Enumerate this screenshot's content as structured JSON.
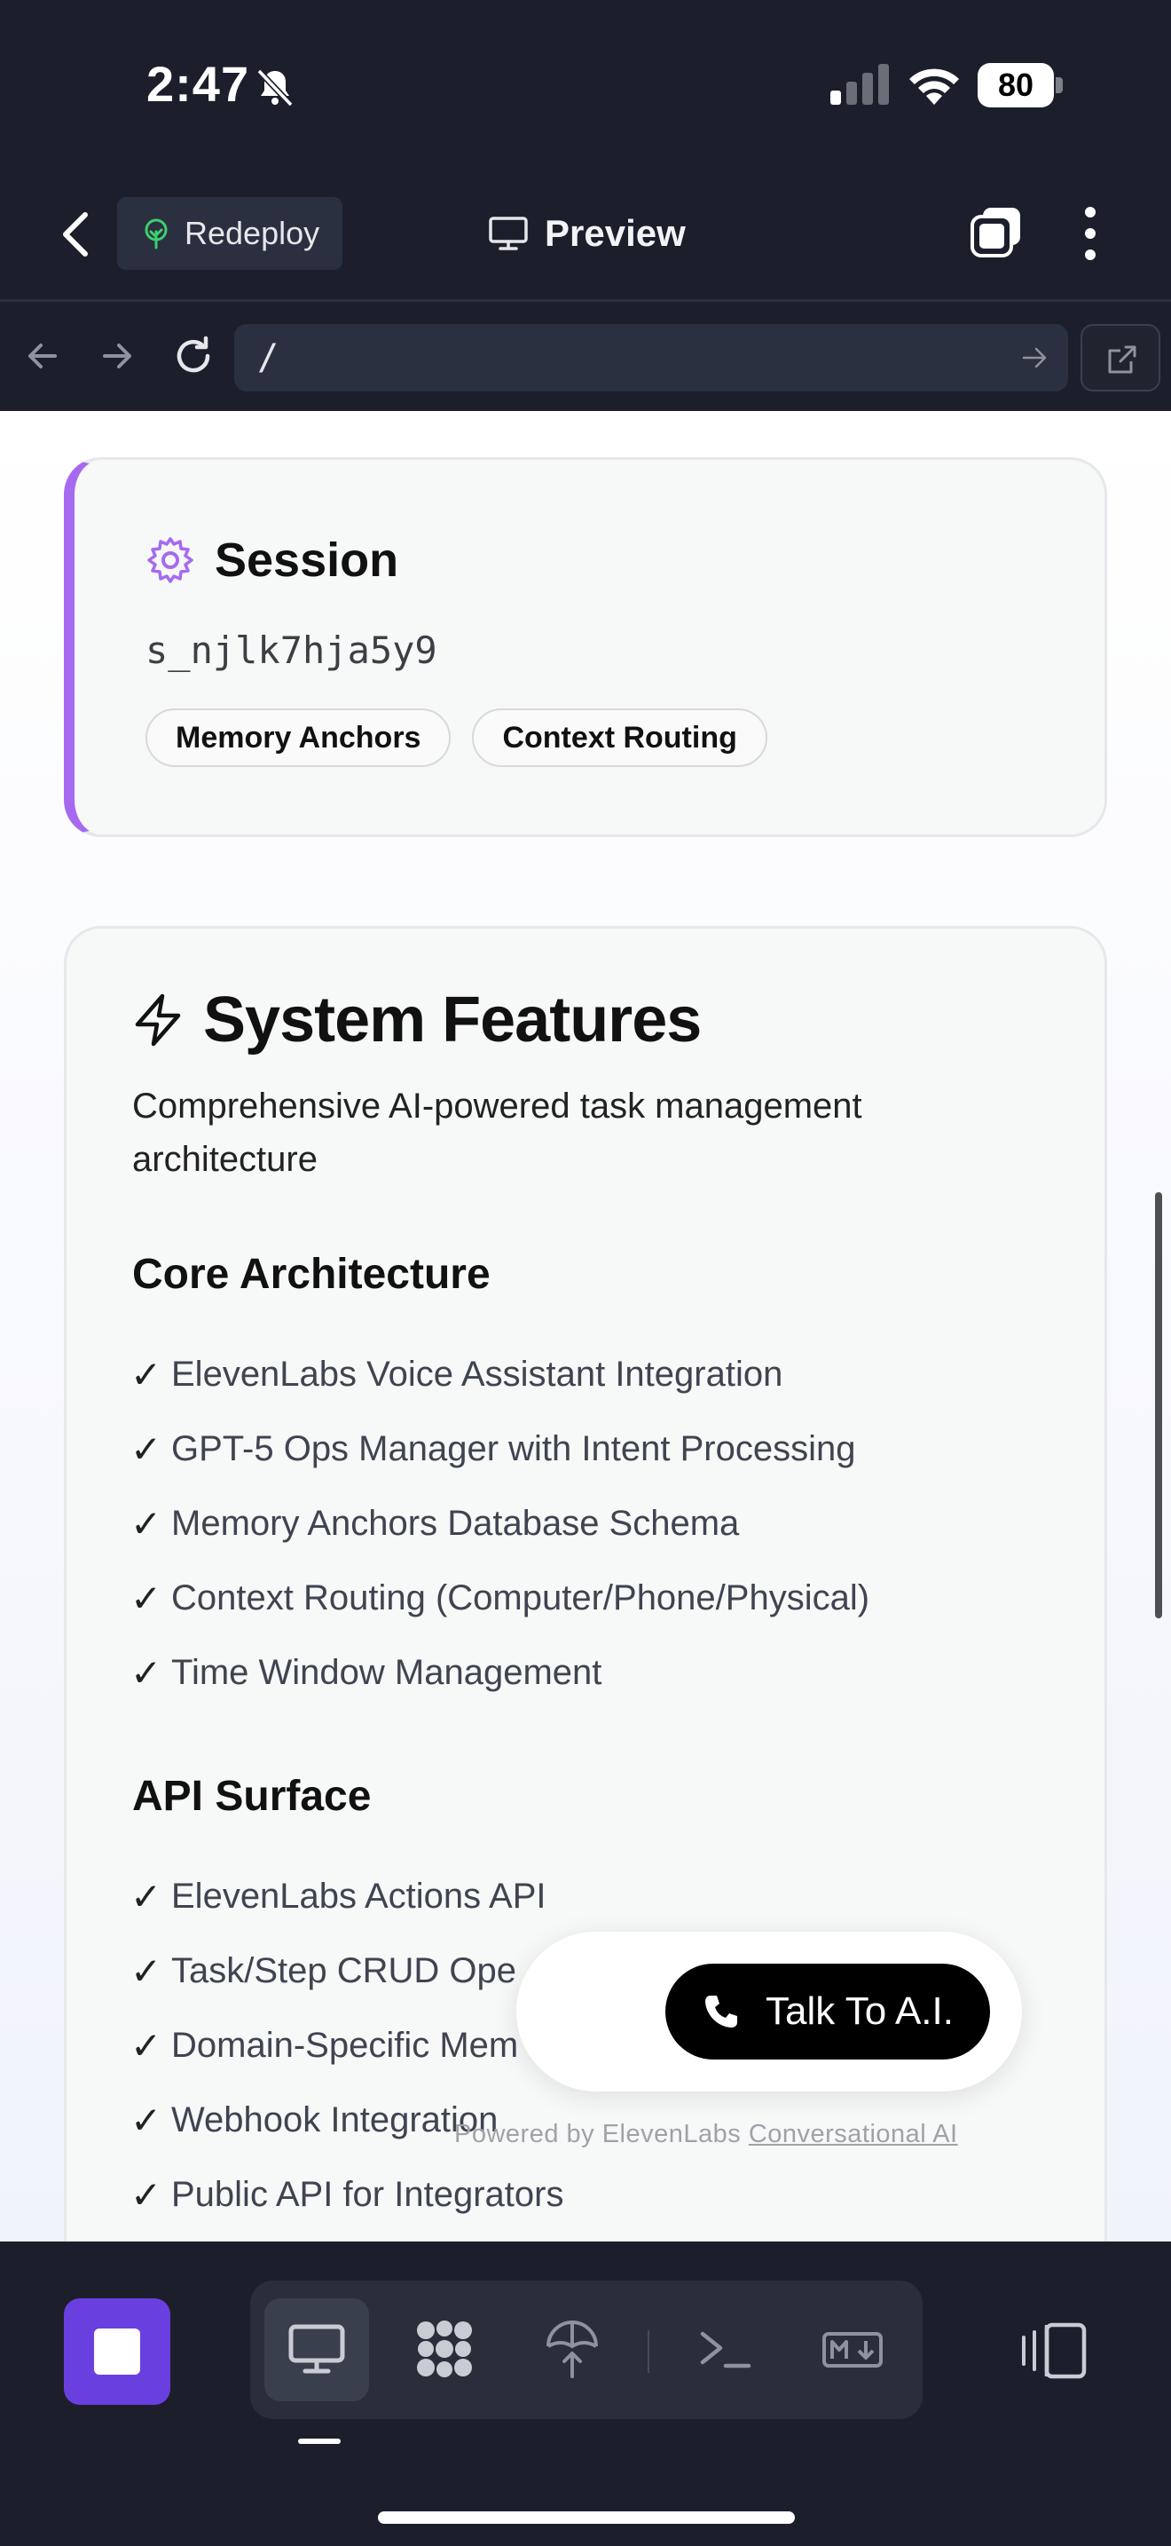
{
  "status_bar": {
    "time": "2:47",
    "battery": "80",
    "icons": [
      "bell-slash-icon",
      "cellular-signal-icon",
      "wifi-icon",
      "battery-icon"
    ]
  },
  "header": {
    "back_icon": "chevron-left-icon",
    "redeploy_label": "Redeploy",
    "redeploy_icon": "tree-icon",
    "title": "Preview",
    "title_icon": "monitor-icon",
    "tabs_icon": "tabs-icon",
    "more_icon": "more-vertical-icon"
  },
  "browser": {
    "url": "/",
    "icons": [
      "arrow-left-icon",
      "arrow-right-icon",
      "refresh-icon",
      "go-arrow-icon",
      "external-link-icon"
    ]
  },
  "session_card": {
    "title": "Session",
    "id": "s_njlk7hja5y9",
    "chips": [
      "Memory Anchors",
      "Context Routing"
    ],
    "accent_color": "#a56af0"
  },
  "features_card": {
    "title": "System Features",
    "subtitle": "Comprehensive AI-powered task management architecture",
    "sections": [
      {
        "heading": "Core Architecture",
        "items": [
          "ElevenLabs Voice Assistant Integration",
          "GPT-5 Ops Manager with Intent Processing",
          "Memory Anchors Database Schema",
          "Context Routing (Computer/Phone/Physical)",
          "Time Window Management"
        ]
      },
      {
        "heading": "API Surface",
        "items": [
          "ElevenLabs Actions API",
          "Task/Step CRUD Ope",
          "Domain-Specific Mem",
          "Webhook Integration",
          "Public API for Integrators"
        ]
      }
    ],
    "check_mark": "✓"
  },
  "voice_widget": {
    "button_label": "Talk To A.I.",
    "powered_by_prefix": "Powered by ElevenLabs ",
    "powered_by_link": "Conversational AI"
  },
  "bottom_toolbar": {
    "stop_color": "#6a3fe0",
    "tools": [
      "monitor-icon",
      "grid-blob-icon",
      "deploy-icon",
      "terminal-icon",
      "markdown-icon"
    ],
    "active_tool": "monitor-icon",
    "layout_icon": "split-layout-icon"
  }
}
